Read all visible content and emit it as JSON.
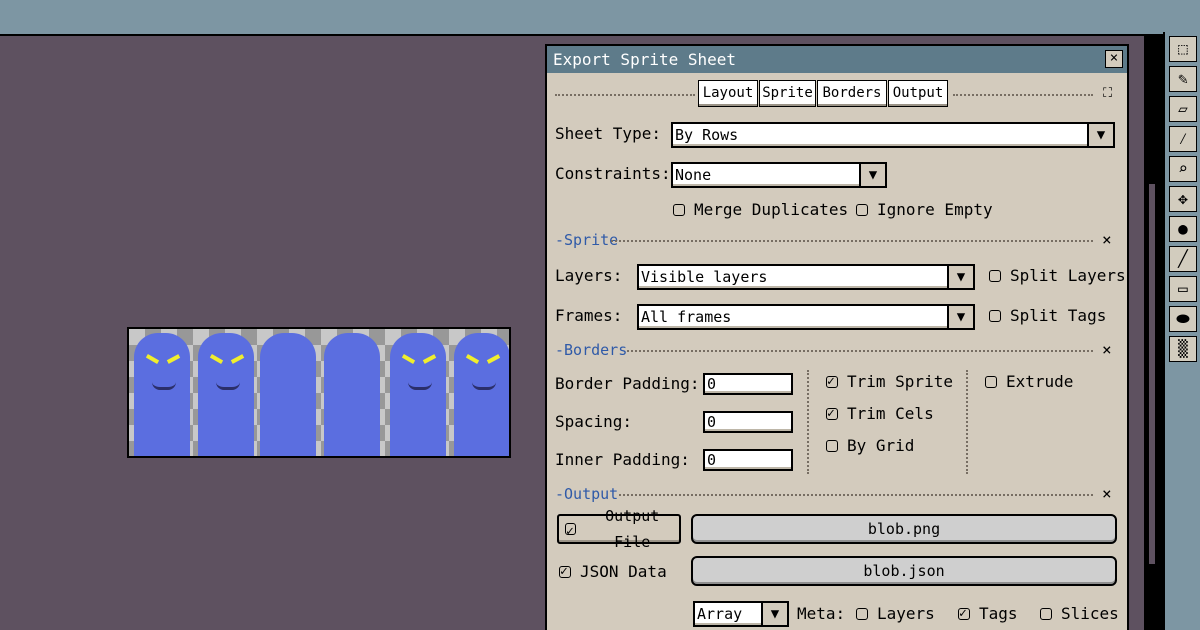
{
  "dialog": {
    "title": "Export Sprite Sheet",
    "close_label": "×",
    "tabs": [
      "Layout",
      "Sprite",
      "Borders",
      "Output"
    ],
    "sheet_type": {
      "label": "Sheet Type:",
      "value": "By Rows"
    },
    "constraints": {
      "label": "Constraints:",
      "value": "None"
    },
    "merge_duplicates": {
      "label": "Merge Duplicates",
      "checked": false
    },
    "ignore_empty": {
      "label": "Ignore Empty",
      "checked": false
    },
    "sprite_section": {
      "title": "-Sprite",
      "layers": {
        "label": "Layers:",
        "value": "Visible layers"
      },
      "split_layers": {
        "label": "Split Layers",
        "checked": false
      },
      "frames": {
        "label": "Frames:",
        "value": "All frames"
      },
      "split_tags": {
        "label": "Split Tags",
        "checked": false
      }
    },
    "borders_section": {
      "title": "-Borders",
      "border_padding": {
        "label": "Border Padding:",
        "value": "0"
      },
      "spacing": {
        "label": "Spacing:",
        "value": "0"
      },
      "inner_padding": {
        "label": "Inner Padding:",
        "value": "0"
      },
      "trim_sprite": {
        "label": "Trim Sprite",
        "checked": true
      },
      "trim_cels": {
        "label": "Trim Cels",
        "checked": true
      },
      "by_grid": {
        "label": "By Grid",
        "checked": false
      },
      "extrude": {
        "label": "Extrude",
        "checked": false
      }
    },
    "output_section": {
      "title": "-Output",
      "output_file": {
        "label": "Output File",
        "checked": true,
        "value": "blob.png"
      },
      "json_data": {
        "label": "JSON Data",
        "checked": true,
        "value": "blob.json"
      },
      "format": {
        "value": "Array"
      },
      "meta_label": "Meta:",
      "meta_layers": {
        "label": "Layers",
        "checked": false
      },
      "meta_tags": {
        "label": "Tags",
        "checked": true
      },
      "meta_slices": {
        "label": "Slices",
        "checked": false
      }
    }
  },
  "sprite_preview": {
    "frame_count": 6
  },
  "toolbar": {
    "tools": [
      "marquee-icon",
      "pencil-icon",
      "eraser-icon",
      "eyedropper-icon",
      "zoom-icon",
      "move-icon",
      "fill-icon",
      "line-icon",
      "rectangle-icon",
      "ellipse-icon",
      "blur-icon"
    ]
  },
  "colors": {
    "canvas": "#5e5160",
    "dialog": "#d3cbbd",
    "titlebar": "#5e7b8a",
    "section": "#2f5aa8",
    "sprite_blue": "#5b6ee0",
    "sprite_eye": "#f0ee2e"
  }
}
